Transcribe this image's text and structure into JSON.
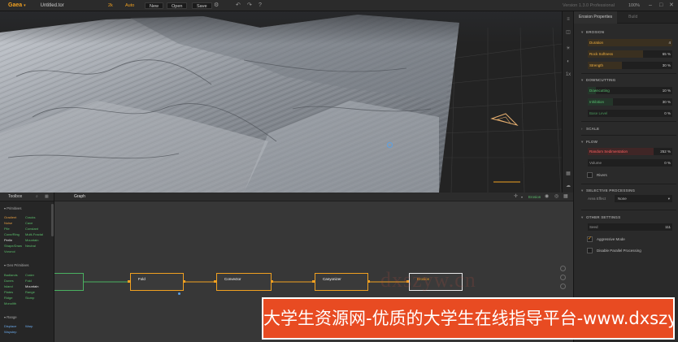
{
  "app": {
    "logo": "Gaea",
    "filename": "Untitled.tor",
    "resolution": "2k",
    "build_mode": "Auto",
    "new_label": "New",
    "open_label": "Open",
    "save_label": "Save",
    "version": "Version 1.3.0 Professional",
    "zoom": "100%"
  },
  "viewport": {
    "icons": [
      "layers-icon",
      "camera-icon",
      "sun-icon",
      "shading-icon",
      "lighting-icon",
      "grid-icon",
      "cloud-icon"
    ],
    "side_label_1": "1x"
  },
  "props": {
    "tabs": [
      "Erosion Properties",
      "Build"
    ],
    "erosion_header": "EROSION",
    "duration": {
      "label": "Duration",
      "value": "4",
      "fill": 1.0
    },
    "rock_softness": {
      "label": "Rock Softness",
      "value": "65",
      "unit": "%",
      "fill": 0.65
    },
    "strength": {
      "label": "Strength",
      "value": "30",
      "unit": "%",
      "fill": 0.4
    },
    "downcutting_header": "DOWNCUTTING",
    "downcutting": {
      "label": "Downcutting",
      "value": "10",
      "unit": "%",
      "fill": 0.1
    },
    "inhibition": {
      "label": "Inhibition",
      "value": "30",
      "unit": "%",
      "fill": 0.3
    },
    "base_level": {
      "label": "Base Level",
      "value": "0",
      "unit": "%",
      "fill": 0.0
    },
    "scale_header": "SCALE",
    "flow_header": "FLOW",
    "random_sedimentation": {
      "label": "Random Sedimentation",
      "value": "252",
      "unit": "%",
      "fill": 0.78
    },
    "volume": {
      "label": "Volume",
      "value": "0",
      "unit": "%",
      "fill": 0.0
    },
    "rivers_label": "Rivers",
    "selective_header": "SELECTIVE PROCESSING",
    "area_effect_label": "Area Effect",
    "area_effect_value": "None",
    "other_header": "OTHER SETTINGS",
    "seed": {
      "label": "Seed",
      "value": "111"
    },
    "aggressive_label": "Aggressive Mode",
    "aggressive_checked": "✓",
    "disable_parallel_label": "Disable Parallel Processing"
  },
  "toolbox": {
    "title": "Toolbox",
    "primitives_header": "Primitives",
    "primitives_col1": [
      "Gradient",
      "Noise",
      "Pile",
      "Cone/Ring",
      "Perlin",
      "Shape/Draw",
      "Voronoi"
    ],
    "primitives_col2": [
      "Cracks",
      "Cave",
      "Constant",
      "Multi-Fractal",
      "Mountain",
      "Neutral"
    ],
    "geo_header": "Geo Primitives",
    "geo_col1": [
      "Badlands",
      "Dunes",
      "Island",
      "Plates",
      "Ridge",
      "Monolith"
    ],
    "geo_col2": [
      "Crater",
      "Fold",
      "Mountain",
      "Range",
      "Slump"
    ],
    "range_header": "Range",
    "range_items": [
      "Displace",
      "Warp",
      "Waystep"
    ]
  },
  "graph": {
    "tab_label": "Graph",
    "active_node_label": "Erosion",
    "nodes": [
      "Fold",
      "Convector",
      "Canyonizer",
      "Erosion"
    ]
  },
  "watermark": {
    "ghost_text": "dxszyw.cn",
    "banner_text": "大学生资源网-优质的大学生在线指导平台-www.dxszyw.cn"
  },
  "colors": {
    "accent": "#f0a020",
    "selection": "#5aa0e6",
    "green": "#58c070",
    "red": "#ff6060",
    "banner": "#e84b22"
  }
}
